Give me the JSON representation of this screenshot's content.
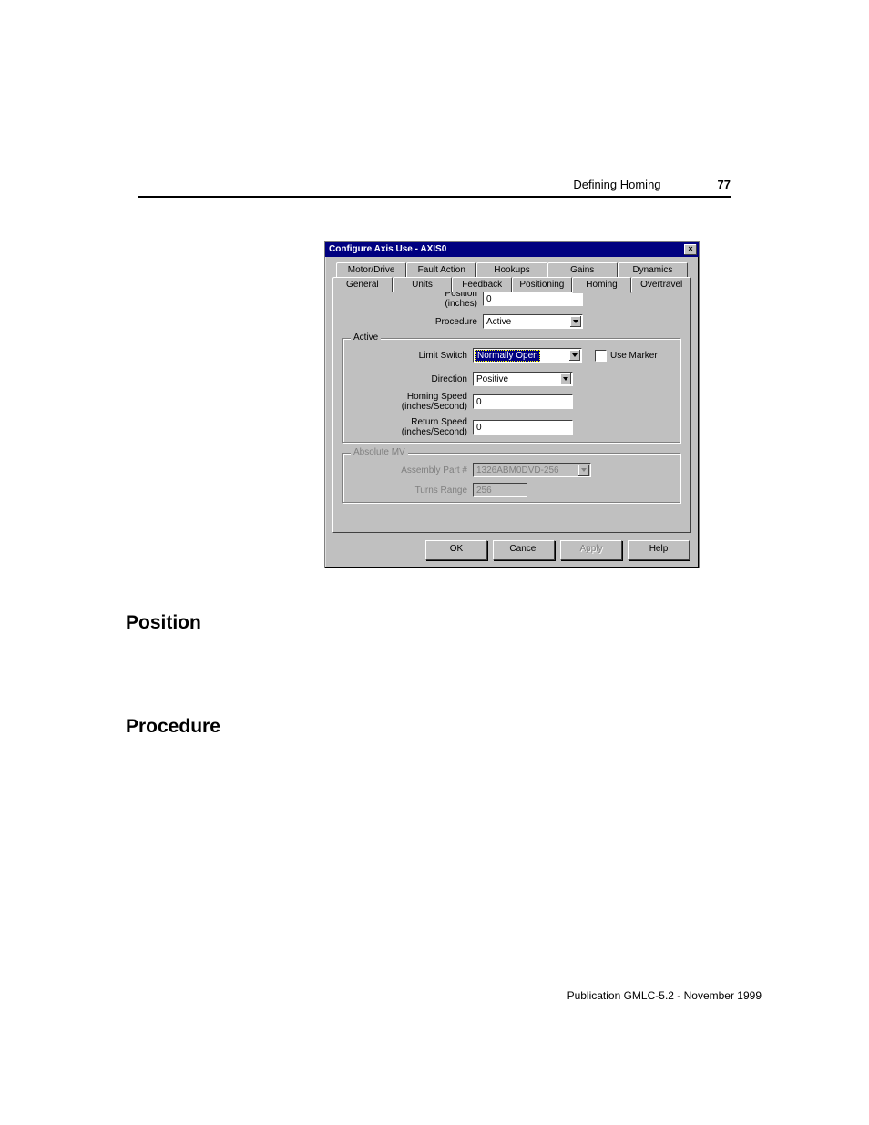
{
  "header": {
    "section_title": "Defining Homing",
    "page_number": "77"
  },
  "dialog": {
    "title": "Configure Axis Use - AXIS0",
    "tabs_back": [
      "Motor/Drive",
      "Fault Action",
      "Hookups",
      "Gains",
      "Dynamics"
    ],
    "tabs_front": [
      "General",
      "Units",
      "Feedback",
      "Positioning",
      "Homing",
      "Overtravel"
    ],
    "active_tab": "Homing",
    "fields": {
      "position_label_line1": "Position",
      "position_label_line2": "(inches)",
      "position_value": "0",
      "procedure_label": "Procedure",
      "procedure_value": "Active"
    },
    "active_group": {
      "legend": "Active",
      "limit_switch_label": "Limit Switch",
      "limit_switch_value": "Normally Open",
      "use_marker_label": "Use Marker",
      "direction_label": "Direction",
      "direction_value": "Positive",
      "homing_speed_label_line1": "Homing Speed",
      "homing_speed_label_line2": "(inches/Second)",
      "homing_speed_value": "0",
      "return_speed_label_line1": "Return Speed",
      "return_speed_label_line2": "(inches/Second)",
      "return_speed_value": "0"
    },
    "absolute_group": {
      "legend": "Absolute MV",
      "assembly_label": "Assembly Part #",
      "assembly_value": "1326ABM0DVD-256",
      "turns_range_label": "Turns Range",
      "turns_range_value": "256"
    },
    "buttons": {
      "ok": "OK",
      "cancel": "Cancel",
      "apply": "Apply",
      "help": "Help"
    }
  },
  "sections": {
    "position": "Position",
    "procedure": "Procedure"
  },
  "footer": {
    "publication": "Publication GMLC-5.2 - November 1999"
  }
}
